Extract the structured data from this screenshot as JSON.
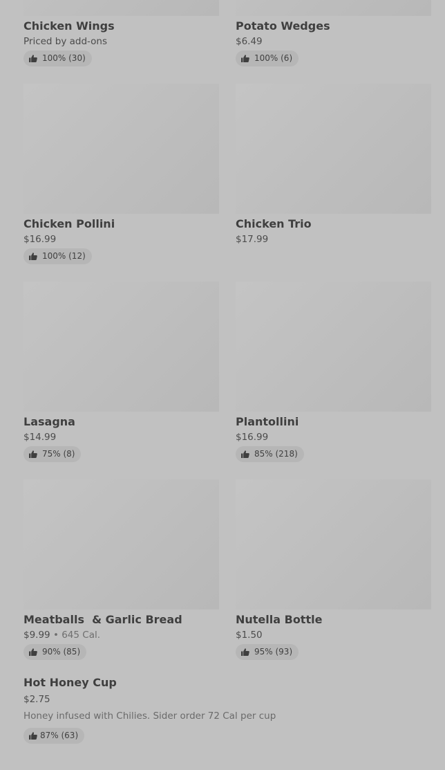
{
  "items": [
    {
      "name": "Chicken Wings",
      "price": "Priced by add-ons",
      "rating": "100% (30)"
    },
    {
      "name": "Potato Wedges",
      "price": "$6.49",
      "rating": "100% (6)"
    },
    {
      "name": "Chicken Pollini",
      "price": "$16.99",
      "rating": "100% (12)"
    },
    {
      "name": "Chicken Trio",
      "price": "$17.99"
    },
    {
      "name": "Lasagna",
      "price": "$14.99",
      "rating": "75% (8)"
    },
    {
      "name": "Plantollini",
      "price": "$16.99",
      "rating": "85% (218)"
    },
    {
      "name": "Meatballs  & Garlic Bread",
      "price": "$9.99",
      "calories": "645 Cal.",
      "rating": "90% (85)"
    },
    {
      "name": "Nutella Bottle",
      "price": "$1.50",
      "rating": "95% (93)"
    }
  ],
  "featured": {
    "name": "Hot Honey Cup",
    "price": "$2.75",
    "description": "Honey infused with Chilies. Sider order 72 Cal per cup",
    "rating": "87% (63)"
  },
  "colors": {
    "overlay_bg": "#c1c1c1",
    "image_placeholder": "#bdbdbd",
    "badge_bg": "#b6b6b6",
    "text": "#3f3f3f"
  },
  "icons": {
    "rating": "thumbs-up-icon"
  }
}
